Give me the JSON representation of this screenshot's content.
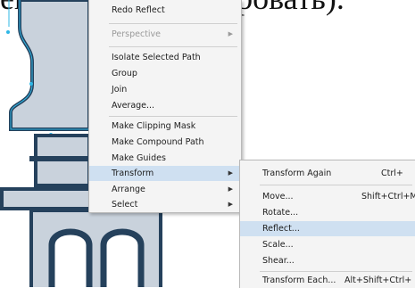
{
  "caption": {
    "text": "ение СОРТ (копировать)."
  },
  "context_menu": {
    "items": [
      {
        "label": "Redo Reflect",
        "disabled": false
      },
      {
        "label": "Perspective",
        "disabled": true,
        "submenu": true
      },
      {
        "label": "Isolate Selected Path",
        "disabled": false
      },
      {
        "label": "Group",
        "disabled": false
      },
      {
        "label": "Join",
        "disabled": false
      },
      {
        "label": "Average...",
        "disabled": false
      },
      {
        "label": "Make Clipping Mask",
        "disabled": false
      },
      {
        "label": "Make Compound Path",
        "disabled": false
      },
      {
        "label": "Make Guides",
        "disabled": false
      },
      {
        "label": "Transform",
        "disabled": false,
        "submenu": true,
        "highlighted": true
      },
      {
        "label": "Arrange",
        "disabled": false,
        "submenu": true
      },
      {
        "label": "Select",
        "disabled": false,
        "submenu": true
      }
    ],
    "arrow_glyph": "▶"
  },
  "transform_submenu": {
    "items": [
      {
        "label": "Transform Again",
        "shortcut": "Ctrl+"
      },
      {
        "label": "Move...",
        "shortcut": "Shift+Ctrl+M"
      },
      {
        "label": "Rotate...",
        "shortcut": ""
      },
      {
        "label": "Reflect...",
        "shortcut": "",
        "highlighted": true
      },
      {
        "label": "Scale...",
        "shortcut": ""
      },
      {
        "label": "Shear...",
        "shortcut": ""
      },
      {
        "label": "Transform Each...",
        "shortcut": "Alt+Shift+Ctrl+"
      }
    ]
  },
  "colors": {
    "artwork_fill": "#c9d2dc",
    "artwork_dark": "#25415c",
    "selection_cyan": "#2fb7e6",
    "menu_highlight": "#cfe0f1",
    "menu_bg": "#f4f4f4"
  }
}
